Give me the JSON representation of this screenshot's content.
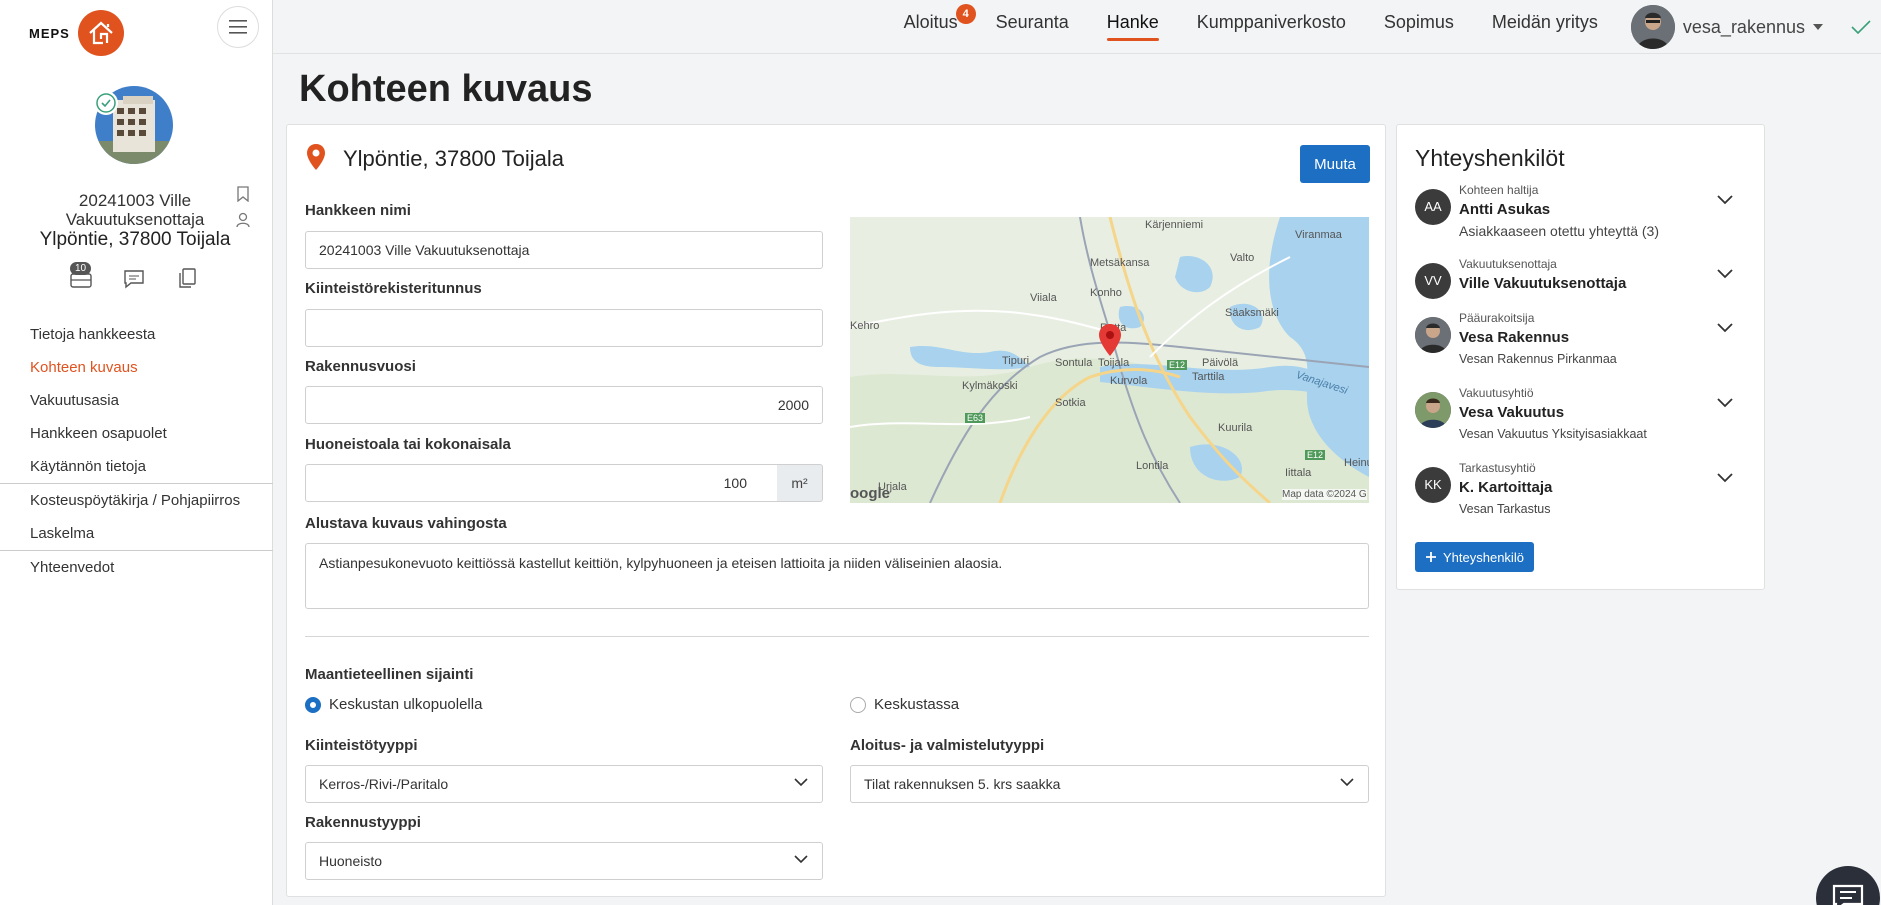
{
  "logo": {
    "text": "MEPS"
  },
  "sidebar": {
    "project_name": "20241003 Ville Vakuutuksenottaja",
    "project_address": "Ylpöntie, 37800 Toijala",
    "doc_count": "10",
    "items": [
      {
        "label": "Tietoja hankkeesta"
      },
      {
        "label": "Kohteen kuvaus"
      },
      {
        "label": "Vakuutusasia"
      },
      {
        "label": "Hankkeen osapuolet"
      },
      {
        "label": "Käytännön tietoja"
      },
      {
        "label": "Kosteuspöytäkirja / Pohjapiirros"
      },
      {
        "label": "Laskelma"
      },
      {
        "label": "Yhteenvedot"
      }
    ]
  },
  "topnav": {
    "tabs": [
      {
        "label": "Aloitus",
        "badge": "4"
      },
      {
        "label": "Seuranta"
      },
      {
        "label": "Hanke"
      },
      {
        "label": "Kumppaniverkosto"
      },
      {
        "label": "Sopimus"
      },
      {
        "label": "Meidän yritys"
      }
    ],
    "username": "vesa_rakennus"
  },
  "page": {
    "title": "Kohteen kuvaus"
  },
  "card": {
    "address": "Ylpöntie, 37800 Toijala",
    "edit_button": "Muuta",
    "fields": {
      "hankkeen_nimi": {
        "label": "Hankkeen nimi",
        "value": "20241003 Ville Vakuutuksenottaja"
      },
      "kiinteisto": {
        "label": "Kiinteistörekisteritunnus",
        "value": ""
      },
      "rakennusvuosi": {
        "label": "Rakennusvuosi",
        "value": "2000"
      },
      "ala": {
        "label": "Huoneistoala tai kokonaisala",
        "value": "100",
        "unit": "m²"
      },
      "kuvaus": {
        "label": "Alustava kuvaus vahingosta",
        "value": "Astianpesukonevuoto keittiössä kastellut keittiön, kylpyhuoneen ja eteisen lattioita ja niiden väliseinien alaosia."
      },
      "sijainti": {
        "label": "Maantieteellinen sijainti",
        "options": [
          "Keskustan ulkopuolella",
          "Keskustassa"
        ],
        "selected": "Keskustan ulkopuolella"
      },
      "kiinteistotyyppi": {
        "label": "Kiinteistötyyppi",
        "value": "Kerros-/Rivi-/Paritalo"
      },
      "aloitustyyppi": {
        "label": "Aloitus- ja valmistelutyyppi",
        "value": "Tilat rakennuksen 5. krs saakka"
      },
      "rakennustyyppi": {
        "label": "Rakennustyyppi",
        "value": "Huoneisto"
      }
    },
    "map": {
      "places": [
        "Kärjenniemi",
        "Viranmaa",
        "Metsäkansa",
        "Valto",
        "Viiala",
        "Konho",
        "Säaksmäki",
        "Kehro",
        "Rotta",
        "Tipuri",
        "Sontula",
        "Toijala",
        "Päivölä",
        "Tarttila",
        "Vanajavesi",
        "Kylmäkoski",
        "Kurvola",
        "Sotkia",
        "Kuurila",
        "Lontila",
        "Iittala",
        "Heinu",
        "Urjala"
      ],
      "roads": [
        "E12",
        "E63",
        "E12"
      ],
      "attribution": "Map data ©2024 G",
      "logo": "oogle"
    }
  },
  "contacts": {
    "title": "Yhteyshenkilöt",
    "add_button": "Yhteyshenkilö",
    "items": [
      {
        "initials": "AA",
        "role": "Kohteen haltija",
        "name": "Antti Asukas",
        "sub": "Asiakkaaseen otettu yhteyttä (3)"
      },
      {
        "initials": "VV",
        "role": "Vakuutuksenottaja",
        "name": "Ville Vakuutuksenottaja",
        "sub": ""
      },
      {
        "initials": "",
        "role": "Pääurakoitsija",
        "name": "Vesa Rakennus",
        "sub": "Vesan Rakennus Pirkanmaa"
      },
      {
        "initials": "",
        "role": "Vakuutusyhtiö",
        "name": "Vesa Vakuutus",
        "sub": "Vesan Vakuutus Yksityisasiakkaat"
      },
      {
        "initials": "KK",
        "role": "Tarkastusyhtiö",
        "name": "K. Kartoittaja",
        "sub": "Vesan Tarkastus"
      }
    ]
  },
  "colors": {
    "accent": "#e0531f",
    "primary": "#1c6fc2"
  }
}
